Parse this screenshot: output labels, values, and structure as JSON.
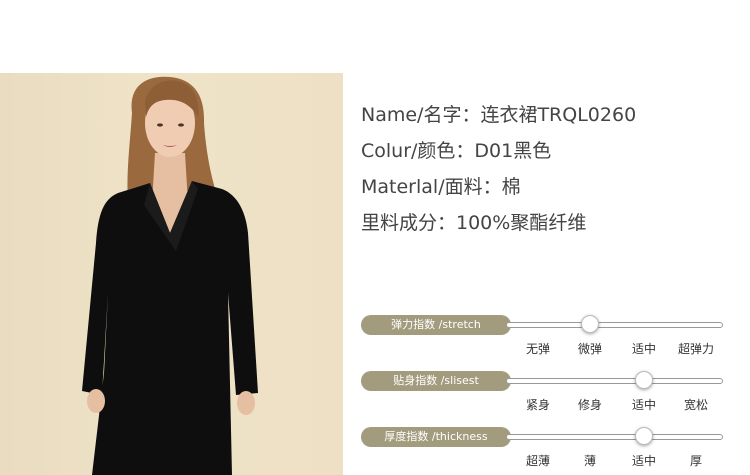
{
  "product": {
    "name_line": "Name/名字：连衣裙TRQL0260",
    "color_line": "Colur/颜色：D01黑色",
    "material_line": "Materlal/面料：棉",
    "lining_line": "里料成分：100%聚酯纤维"
  },
  "photo": {
    "alt": "model wearing black wrap dress"
  },
  "sliders": [
    {
      "label": "弹力指数 /stretch",
      "options": [
        "无弹",
        "微弹",
        "适中",
        "超弹力"
      ],
      "selected_index": 1
    },
    {
      "label": "贴身指数 /slisest",
      "options": [
        "紧身",
        "修身",
        "适中",
        "宽松"
      ],
      "selected_index": 2
    },
    {
      "label": "厚度指数 /thickness",
      "options": [
        "超薄",
        "薄",
        "适中",
        "厚"
      ],
      "selected_index": 2
    }
  ],
  "colors": {
    "pill": "#a39b7e",
    "photo_bg": "#ece0c4",
    "dress": "#0e0e0e"
  }
}
